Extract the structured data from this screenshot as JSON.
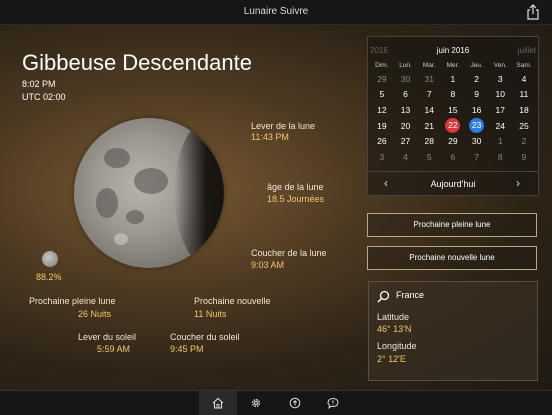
{
  "app": {
    "title": "Lunaire Suivre"
  },
  "moon": {
    "phase_name": "Gibbeuse Descendante",
    "time": "8:02 PM",
    "utc": "UTC 02:00",
    "illumination": "88.2%",
    "moonrise_label": "Lever de la lune",
    "moonrise_value": "11:43 PM",
    "age_label": "âge de la lune",
    "age_value": "18.5 Journées",
    "moonset_label": "Coucher de la lune",
    "moonset_value": "9:03 AM",
    "next_full_label": "Prochaine pleine lune",
    "next_full_value": "26 Nuits",
    "next_new_label": "Prochaine nouvelle",
    "next_new_value": "11 Nuits",
    "sunrise_label": "Lever du soleil",
    "sunrise_value": "5:59 AM",
    "sunset_label": "Coucher du soleil",
    "sunset_value": "9:45 PM"
  },
  "calendar": {
    "prev": "2016",
    "month": "juin 2016",
    "next": "juillet",
    "days_of_week": [
      "Dim.",
      "Lun.",
      "Mar.",
      "Mer.",
      "Jeu.",
      "Ven.",
      "Sam."
    ],
    "weeks": [
      [
        "29",
        "30",
        "31",
        "1",
        "2",
        "3",
        "4"
      ],
      [
        "5",
        "6",
        "7",
        "8",
        "9",
        "10",
        "11"
      ],
      [
        "12",
        "13",
        "14",
        "15",
        "16",
        "17",
        "18"
      ],
      [
        "19",
        "20",
        "21",
        "22",
        "23",
        "24",
        "25"
      ],
      [
        "26",
        "27",
        "28",
        "29",
        "30",
        "1",
        "2"
      ],
      [
        "3",
        "4",
        "5",
        "6",
        "7",
        "8",
        "9"
      ]
    ],
    "today_label": "Aujourd'hui",
    "prev_arrow": "‹",
    "next_arrow": "›"
  },
  "buttons": {
    "next_full": "Prochaine pleine lune",
    "next_new": "Prochaine nouvelle lune"
  },
  "location": {
    "country": "France",
    "latitude_label": "Latitude",
    "latitude_value": "46° 13'N",
    "longitude_label": "Longitude",
    "longitude_value": "2° 12'E"
  },
  "icons": {
    "share": "share-icon",
    "search": "search-icon",
    "home": "home-icon",
    "settings": "gear-icon",
    "info": "info-icon",
    "chat": "chat-icon"
  },
  "colors": {
    "accent_value": "#f3c86b",
    "today_red": "#d9393a",
    "selected_blue": "#2a7fe0"
  }
}
